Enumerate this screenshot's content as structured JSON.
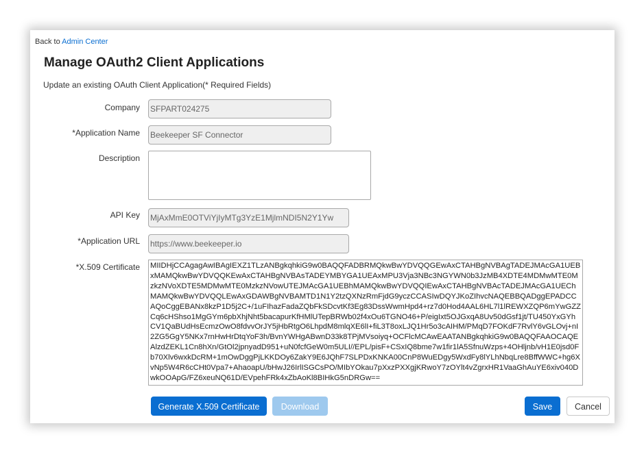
{
  "nav": {
    "back_prefix": "Back to ",
    "back_link": "Admin Center"
  },
  "page": {
    "title": "Manage OAuth2 Client Applications",
    "subtitle": "Update an existing OAuth Client Application(* Required Fields)"
  },
  "form": {
    "company": {
      "label": "Company",
      "value": "SFPART024275"
    },
    "application_name": {
      "label": "*Application Name",
      "value": "Beekeeper SF Connector"
    },
    "description": {
      "label": "Description",
      "value": ""
    },
    "api_key": {
      "label": "API Key",
      "value": "MjAxMmE0OTViYjIyMTg3YzE1MjlmNDI5N2Y1Yw"
    },
    "application_url": {
      "label": "*Application URL",
      "value": "https://www.beekeeper.io"
    },
    "certificate": {
      "label": "*X.509 Certificate",
      "value": "MIIDHjCCAgagAwIBAgIEXZ1TLzANBgkqhkiG9w0BAQQFADBRMQkwBwYDVQQGEwAxCTAHBgNVBAgTADEJMAcGA1UEBxMAMQkwBwYDVQQKEwAxCTAHBgNVBAsTADEYMBYGA1UEAxMPU3Vja3NBc3NGYWN0b3JzMB4XDTE4MDMwMTE0MzkzNVoXDTE5MDMwMTE0MzkzNVowUTEJMAcGA1UEBhMAMQkwBwYDVQQIEwAxCTAHBgNVBAcTADEJMAcGA1UEChMAMQkwBwYDVQQLEwAxGDAWBgNVBAMTD1N1Y2tzQXNzRmFjdG9yczCCASIwDQYJKoZIhvcNAQEBBQADggEPADCCAQoCggEBANx8kzP1D5j2C+/1uFIhazFadaZQbFkSDcvtKf3Eg83DssWwmHpd4+rz7d0Hod4AAL6HL7l1lREWXZQP6mYwGZZCq6cHShso1MgGYm6pbXhjNht5bacapurKfHMlUTepBRWb02f4xOu6TGNO46+P/eigIxt5OJGxqA8Uv50dGsf1jt/TU450YxGYhCV1QaBUdHsEcmzOwO8fdvvOrJY5jHbRtgO6LhpdM8mlqXE6lI+fiL3T8oxLJQ1Hr5o3cAIHM/PMqD7FOKdF7RvlY6vGLOvj+nI2ZG5GgY5NKx7rnHwHrDtqYoF3h/BvnYWHgABwnD33k8TPjMVsoiyq+OCFlcMCAwEAATANBgkqhkiG9w0BAQQFAAOCAQEAlzdZEKL1Cn8hXn/GtOl2jpnyadD951+uN0fcfGeW0m5ULI//EPL/pisF+CSxIQ8bme7w1fir1lA5SfnuWzps+4OHljnb/vH1E0jsd0Fb70Xlv6wxkDcRM+1mOwDggPjLKKDOy6ZakY9E6JQhF7SLPDxKNKA00CnP8WuEDgy5WxdFy8lYLhNbqLre8BffWWC+hg6XvNp5W4R6cCHt0Vpa7+AhaoapU/bHwJ26IrlISGCsPO/MIbYOkau7pXxzPXXgjKRwoY7zOYlt4vZgrxHR1VaaGhAuYE6xiv040DwkOOApG/FZ6xeuNQ61D/EVpehFRk4xZbAoKl8BIHkG5nDRGw=="
    }
  },
  "buttons": {
    "generate": "Generate X.509 Certificate",
    "download": "Download",
    "save": "Save",
    "cancel": "Cancel"
  },
  "colors": {
    "primary": "#0a6ed1",
    "primary_disabled": "#9ec9ee",
    "field_bg": "#efefef"
  }
}
